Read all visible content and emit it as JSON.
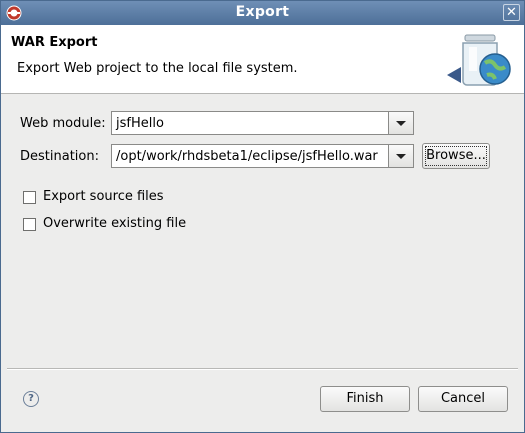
{
  "window": {
    "title": "Export"
  },
  "header": {
    "title": "WAR Export",
    "description": "Export Web project to the local file system."
  },
  "form": {
    "web_module": {
      "label": "Web module:",
      "value": "jsfHello"
    },
    "destination": {
      "label": "Destination:",
      "value": "/opt/work/rhdsbeta1/eclipse/jsfHello.war"
    },
    "browse_label": "Browse...",
    "export_source": {
      "label": "Export source files",
      "checked": false
    },
    "overwrite": {
      "label": "Overwrite existing file",
      "checked": false
    }
  },
  "footer": {
    "help_glyph": "?",
    "finish_label": "Finish",
    "cancel_label": "Cancel"
  }
}
